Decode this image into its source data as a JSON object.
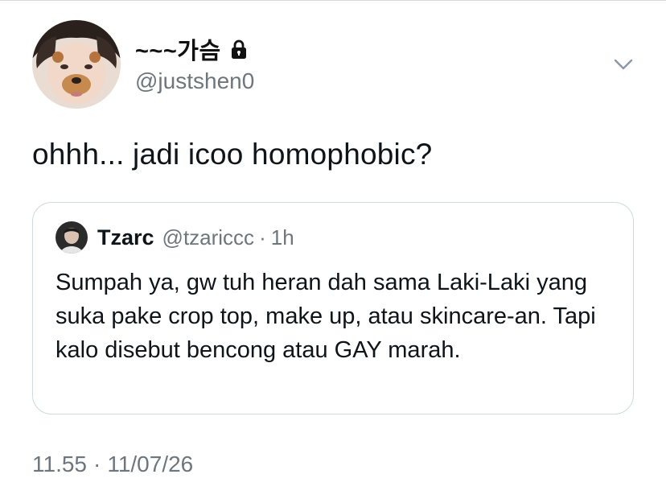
{
  "author": {
    "display_name": "~~~가슴",
    "handle": "@justshen0",
    "protected_icon": "lock-icon"
  },
  "menu": {
    "icon": "chevron-down-icon"
  },
  "tweet": {
    "text": "ohhh... jadi icoo homophobic?"
  },
  "quoted_tweet": {
    "display_name": "Tzarc",
    "handle": "@tzariccc",
    "separator": "·",
    "time": "1h",
    "text": "Sumpah ya, gw tuh heran dah sama Laki-Laki yang suka pake crop top, make up, atau skincare-an. Tapi kalo disebut bencong atau GAY marah."
  },
  "timestamp": {
    "time": "11.55",
    "separator": "·",
    "date": "11/07/26"
  },
  "colors": {
    "text_primary": "#0f1419",
    "text_secondary": "#6e767d",
    "border": "#cfd9de"
  }
}
